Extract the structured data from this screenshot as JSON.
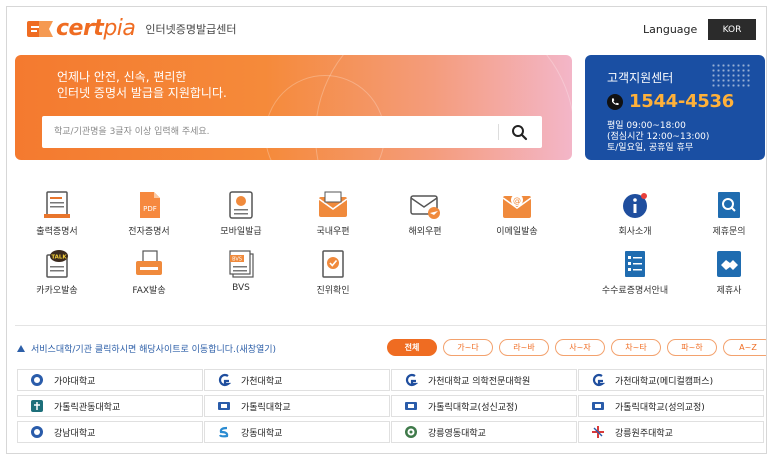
{
  "header": {
    "logo_text_cert": "cert",
    "logo_text_pia": "pia",
    "logo_subtitle": "인터넷증명발급센터",
    "language_label": "Language",
    "language_value": "KOR"
  },
  "hero": {
    "line1": "언제나 안전, 신속, 편리한",
    "line2": "인터넷 증명서 발급을 지원합니다.",
    "search_placeholder": "학교/기관명을 3글자 이상 입력해 주세요."
  },
  "support": {
    "title": "고객지원센터",
    "phone": "1544-4536",
    "hours1": "평일 09:00~18:00",
    "hours2": "(점심시간 12:00~13:00)",
    "hours3": "토/일요일, 공휴일 휴무"
  },
  "menu": {
    "row1": [
      "출력증명서",
      "전자증명서",
      "모바일발급",
      "국내우편",
      "해외우편",
      "이메일발송",
      "회사소개",
      "제휴문의"
    ],
    "row2": [
      "카카오발송",
      "FAX발송",
      "BVS",
      "진위확인",
      "수수료증명서안내",
      "제휴사"
    ],
    "pdf_text": "PDF",
    "talk_text": "TALK",
    "bvs_text": "BVS"
  },
  "filter": {
    "notice": "서비스대학/기관 클릭하시면 해당사이트로 이동합니다.(새창열기)",
    "tabs": [
      "전체",
      "가~다",
      "라~바",
      "사~자",
      "차~타",
      "파~하",
      "A~Z"
    ]
  },
  "schools": [
    [
      "가야대학교",
      "가천대학교",
      "가천대학교 의학전문대학원",
      "가천대학교(메디컬캠퍼스)"
    ],
    [
      "가톨릭관동대학교",
      "가톨릭대학교",
      "가톨릭대학교(성신교정)",
      "가톨릭대학교(성의교정)"
    ],
    [
      "강남대학교",
      "강동대학교",
      "강릉영동대학교",
      "강릉원주대학교"
    ]
  ],
  "colors": {
    "brand_orange": "#ef6c22",
    "support_blue": "#1a4fa3",
    "phone_yellow": "#ffb13a"
  }
}
